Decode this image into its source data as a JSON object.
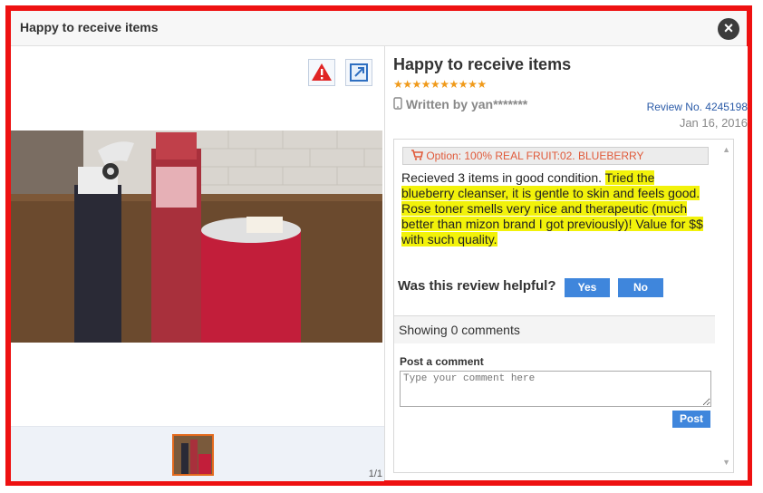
{
  "modal": {
    "title": "Happy to receive items"
  },
  "gallery": {
    "page_count": "1/1"
  },
  "review": {
    "title": "Happy to receive items",
    "stars": "★★★★★★★★★★",
    "written_by": "Written by yan*******",
    "review_no": "Review No. 4245198",
    "date": "Jan 16, 2016",
    "option": "Option: 100% REAL FRUIT:02. BLUEBERRY",
    "text_plain": "Recieved 3 items in good condition. ",
    "text_highlight": "Tried the blueberry cleanser, it is gentle to skin and feels good. Rose toner smells very nice and therapeutic (much better than mizon brand I got previously)! Value for $$ with such quality."
  },
  "helpful": {
    "question": "Was this review helpful?",
    "yes": "Yes",
    "no": "No"
  },
  "comments": {
    "showing": "Showing 0 comments",
    "post_label": "Post a comment",
    "placeholder": "Type your comment here",
    "post_button": "Post"
  },
  "colors": {
    "frame": "#ee1111",
    "accent": "#3f86dc",
    "highlight": "#f2f20a",
    "stars": "#f09a1a",
    "option_text": "#e05a3a"
  },
  "icons": {
    "close": "close-icon",
    "report": "warning-icon",
    "expand": "expand-icon",
    "mobile": "mobile-icon",
    "cart": "cart-icon"
  }
}
